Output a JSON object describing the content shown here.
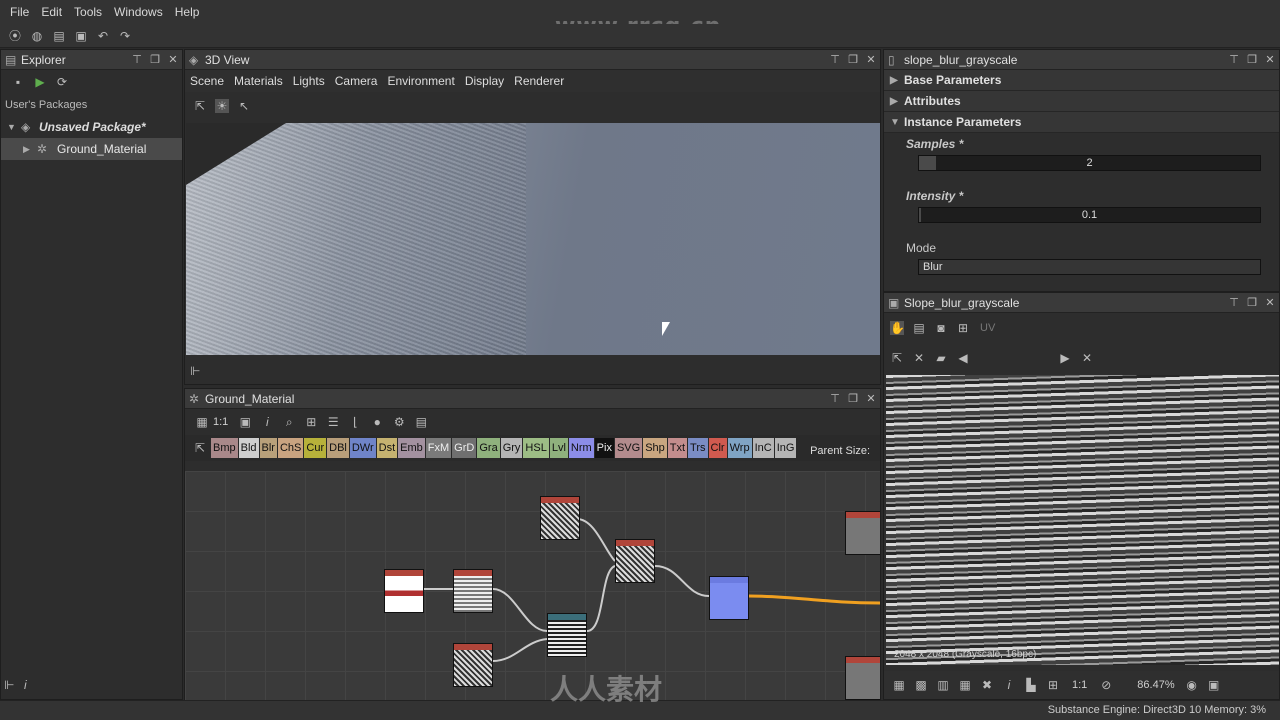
{
  "menu": [
    "File",
    "Edit",
    "Tools",
    "Windows",
    "Help"
  ],
  "watermark_top": "www.rrcg.cn",
  "watermark_bottom": "人人素材",
  "explorer": {
    "title": "Explorer",
    "packages_label": "User's Packages",
    "package": "Unsaved Package*",
    "graph_item": "Ground_Material"
  },
  "view3d": {
    "title": "3D View",
    "menu": [
      "Scene",
      "Materials",
      "Lights",
      "Camera",
      "Environment",
      "Display",
      "Renderer"
    ]
  },
  "graph": {
    "title": "Ground_Material",
    "zoom_label": "1:1",
    "parent_size_label": "Parent Size:",
    "chips": [
      {
        "label": "Bmp",
        "color": "#a9888a"
      },
      {
        "label": "Bld",
        "color": "#cfcfcf"
      },
      {
        "label": "Blr",
        "color": "#b8a07a"
      },
      {
        "label": "ChS",
        "color": "#c9a380"
      },
      {
        "label": "Cur",
        "color": "#b7b13a"
      },
      {
        "label": "DBl",
        "color": "#b89e7a"
      },
      {
        "label": "DWr",
        "color": "#6f84c9"
      },
      {
        "label": "Dst",
        "color": "#c5b270"
      },
      {
        "label": "Emb",
        "color": "#a391a0"
      },
      {
        "label": "FxM",
        "color": "#7a7a7a"
      },
      {
        "label": "GrD",
        "color": "#6f6f6f"
      },
      {
        "label": "Gra",
        "color": "#8fb17d"
      },
      {
        "label": "Gry",
        "color": "#b5b5b5"
      },
      {
        "label": "HSL",
        "color": "#9dbd85"
      },
      {
        "label": "Lvl",
        "color": "#8fb17d"
      },
      {
        "label": "Nrm",
        "color": "#8c8de8"
      },
      {
        "label": "Pix",
        "color": "#d8d8d8"
      },
      {
        "label": "SVG",
        "color": "#b38b8d"
      },
      {
        "label": "Shp",
        "color": "#c9a680"
      },
      {
        "label": "Txt",
        "color": "#c38d8d"
      },
      {
        "label": "Trs",
        "color": "#7a8cc4"
      },
      {
        "label": "Clr",
        "color": "#d05a4f"
      },
      {
        "label": "Wrp",
        "color": "#7fa4c4"
      },
      {
        "label": "InC",
        "color": "#b5b5b5"
      },
      {
        "label": "InG",
        "color": "#b5b5b5"
      }
    ]
  },
  "properties": {
    "title": "slope_blur_grayscale",
    "sections": [
      "Base Parameters",
      "Attributes",
      "Instance Parameters"
    ],
    "samples": {
      "label": "Samples *",
      "value": "2",
      "fraction": 0.05
    },
    "intensity": {
      "label": "Intensity *",
      "value": "0.1",
      "fraction": 0.005
    },
    "mode": {
      "label": "Mode",
      "value": "Blur"
    }
  },
  "preview": {
    "title": "Slope_blur_grayscale",
    "info": "2048 x 2048 (Grayscale, 16bpc)",
    "uv_label": "UV",
    "zoom": "86.47%",
    "ratio": "1:1"
  },
  "status": "Substance Engine: Direct3D 10  Memory: 3%"
}
